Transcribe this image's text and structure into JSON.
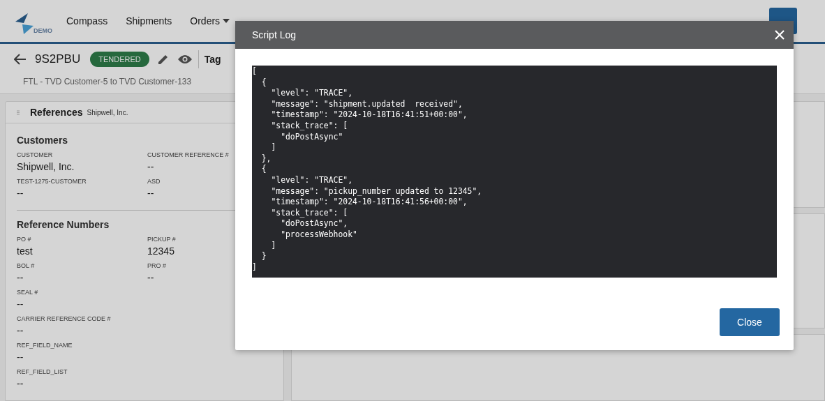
{
  "top_nav": {
    "logo_caption": "DEMO",
    "items": [
      {
        "label": "Compass",
        "has_menu": false
      },
      {
        "label": "Shipments",
        "has_menu": false
      },
      {
        "label": "Orders",
        "has_menu": true
      }
    ]
  },
  "shipment_header": {
    "id": "9S2PBU",
    "status": "TENDERED",
    "tags_label": "Tag",
    "subtitle": "FTL - TVD Customer-5 to TVD Customer-133"
  },
  "references_card": {
    "title": "References",
    "company": "Shipwell, Inc.",
    "sections": [
      {
        "title": "Customers",
        "rows": [
          [
            {
              "label": "CUSTOMER",
              "value": "Shipwell, Inc."
            },
            {
              "label": "CUSTOMER REFERENCE #",
              "value": "--"
            }
          ],
          [
            {
              "label": "TEST-1275-CUSTOMER",
              "value": "--"
            },
            {
              "label": "ASD",
              "value": "--"
            }
          ]
        ]
      },
      {
        "title": "Reference Numbers",
        "rows": [
          [
            {
              "label": "PO #",
              "value": "test"
            },
            {
              "label": "PICKUP #",
              "value": "12345"
            }
          ],
          [
            {
              "label": "BOL #",
              "value": "--"
            },
            {
              "label": "PRO #",
              "value": "--"
            }
          ],
          [
            {
              "label": "SEAL #",
              "value": "--"
            }
          ],
          [
            {
              "label": "CARRIER REFERENCE CODE #",
              "value": "--"
            }
          ],
          [
            {
              "label": "REF_FIELD_NAME",
              "value": "--"
            }
          ],
          [
            {
              "label": "REF_FIELD_LIST",
              "value": "--"
            }
          ]
        ]
      }
    ]
  },
  "modal": {
    "title": "Script Log",
    "log_text": "[\n  {\n    \"level\": \"TRACE\",\n    \"message\": \"shipment.updated  received\",\n    \"timestamp\": \"2024-10-18T16:41:51+00:00\",\n    \"stack_trace\": [\n      \"doPostAsync\"\n    ]\n  },\n  {\n    \"level\": \"TRACE\",\n    \"message\": \"pickup_number updated to 12345\",\n    \"timestamp\": \"2024-10-18T16:41:56+00:00\",\n    \"stack_trace\": [\n      \"doPostAsync\",\n      \"processWebhook\"\n    ]\n  }\n]",
    "close_button": "Close"
  }
}
